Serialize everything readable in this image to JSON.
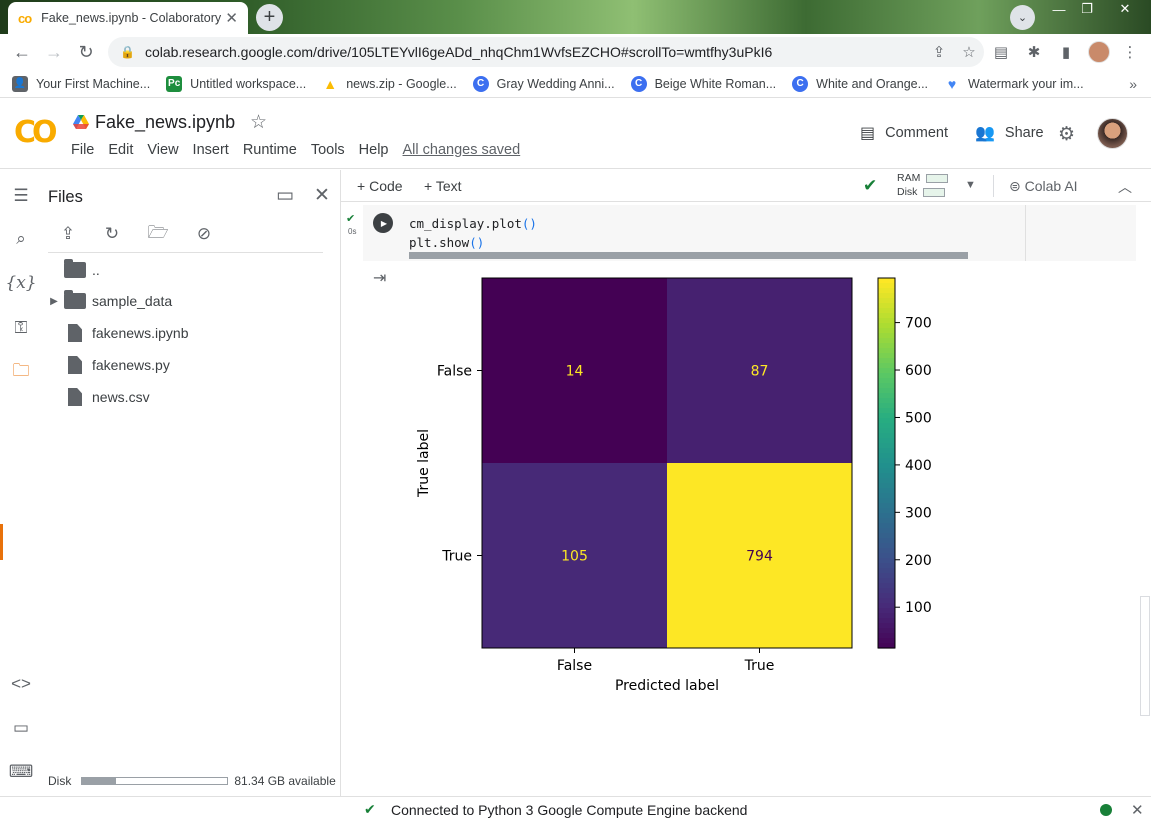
{
  "browser": {
    "tab_title": "Fake_news.ipynb - Colaboratory",
    "tab_favicon": "co",
    "url": "colab.research.google.com/drive/105LTEYvlI6geADd_nhqChm1WvfsEZCHO#scrollTo=wmtfhy3uPkI6",
    "bookmarks": [
      {
        "label": "Your First Machine...",
        "icon": "person-icon",
        "color": "#5f6368"
      },
      {
        "label": "Untitled workspace...",
        "icon": "workspace-icon",
        "color": "#1e8e3e"
      },
      {
        "label": "news.zip - Google...",
        "icon": "drive-icon",
        "color": "#fbbc04"
      },
      {
        "label": "Gray Wedding Anni...",
        "icon": "canva-icon",
        "color": "#3c6ff0"
      },
      {
        "label": "Beige White Roman...",
        "icon": "canva-icon",
        "color": "#3c6ff0"
      },
      {
        "label": "White and Orange...",
        "icon": "canva-icon",
        "color": "#3c6ff0"
      },
      {
        "label": "Watermark your im...",
        "icon": "heart-icon",
        "color": "#4285f4"
      }
    ],
    "bookmarks_more": "»"
  },
  "colab": {
    "logo": "CO",
    "notebook_title": "Fake_news.ipynb",
    "menu": [
      "File",
      "Edit",
      "View",
      "Insert",
      "Runtime",
      "Tools",
      "Help"
    ],
    "save_status": "All changes saved",
    "comment_label": "Comment",
    "share_label": "Share"
  },
  "files_panel": {
    "title": "Files",
    "items": [
      {
        "label": "..",
        "kind": "folder",
        "expandable": false
      },
      {
        "label": "sample_data",
        "kind": "folder",
        "expandable": true
      },
      {
        "label": "fakenews.ipynb",
        "kind": "file",
        "expandable": false
      },
      {
        "label": "fakenews.py",
        "kind": "file",
        "expandable": false
      },
      {
        "label": "news.csv",
        "kind": "file",
        "expandable": false
      }
    ],
    "disk_label": "Disk",
    "disk_used_fraction": 0.23,
    "disk_available": "81.34 GB available"
  },
  "toolbar": {
    "add_code": "Code",
    "add_text": "Text",
    "ram_label": "RAM",
    "disk_label": "Disk",
    "colab_ai": "Colab AI"
  },
  "cell": {
    "exec_time": "0s",
    "code_line1": "cm_display.plot",
    "code_line2": "plt.show",
    "parens": "()"
  },
  "chart_data": {
    "type": "heatmap",
    "title": "",
    "xlabel": "Predicted label",
    "ylabel": "True label",
    "x_categories": [
      "False",
      "True"
    ],
    "y_categories": [
      "False",
      "True"
    ],
    "values": [
      [
        14,
        87
      ],
      [
        105,
        794
      ]
    ],
    "colormap": "viridis",
    "colorbar_ticks": [
      100,
      200,
      300,
      400,
      500,
      600,
      700
    ],
    "colorbar_range": [
      14,
      794
    ]
  },
  "status_bar": {
    "text": "Connected to Python 3 Google Compute Engine backend"
  }
}
